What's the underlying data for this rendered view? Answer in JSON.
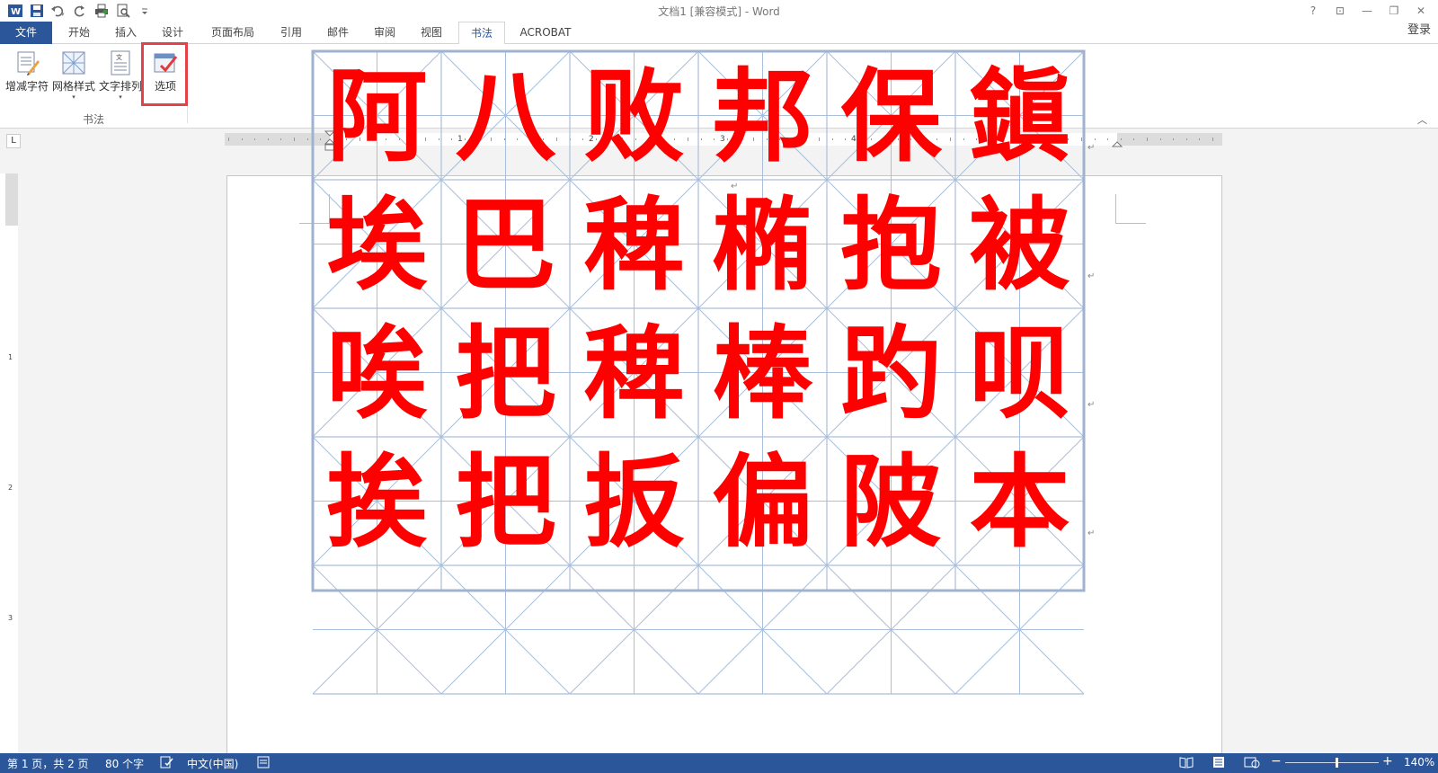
{
  "app": {
    "title": "文档1 [兼容模式] - Word"
  },
  "window_buttons": [
    "?",
    "⊡",
    "—",
    "❐",
    "✕"
  ],
  "tabs": [
    {
      "label": "文件"
    },
    {
      "label": "开始"
    },
    {
      "label": "插入"
    },
    {
      "label": "设计"
    },
    {
      "label": "页面布局"
    },
    {
      "label": "引用"
    },
    {
      "label": "邮件"
    },
    {
      "label": "审阅"
    },
    {
      "label": "视图"
    },
    {
      "label": "书法"
    },
    {
      "label": "ACROBAT"
    }
  ],
  "active_tab": "书法",
  "login": "登录",
  "ribbon": {
    "buttons": [
      {
        "label": "增减字符"
      },
      {
        "label": "网格样式"
      },
      {
        "label": "文字排列"
      },
      {
        "label": "选项"
      }
    ],
    "group_label": "书法"
  },
  "ruler": {
    "numbers": [
      "1",
      "2",
      "3",
      "4",
      "5"
    ],
    "tab_selector": "L"
  },
  "vruler": {
    "numbers": [
      "1",
      "2",
      "3"
    ]
  },
  "document": {
    "characters": [
      [
        "阿",
        "八",
        "败",
        "邦",
        "保",
        "鎭"
      ],
      [
        "埃",
        "巴",
        "稗",
        "椭",
        "抱",
        "被"
      ],
      [
        "唉",
        "把",
        "稗",
        "棒",
        "趵",
        "呗"
      ],
      [
        "挨",
        "把",
        "扳",
        "偏",
        "陂",
        "本"
      ]
    ],
    "char_color": "#ff0000",
    "grid_color": "#a9bfdb",
    "para_mark": "↵"
  },
  "status": {
    "page": "第 1 页，共 2 页",
    "words": "80 个字",
    "language": "中文(中国)",
    "zoom": "140%",
    "zoom_minus": "−",
    "zoom_plus": "+"
  },
  "colors": {
    "accent": "#2b579a",
    "highlight": "#e5414b"
  }
}
